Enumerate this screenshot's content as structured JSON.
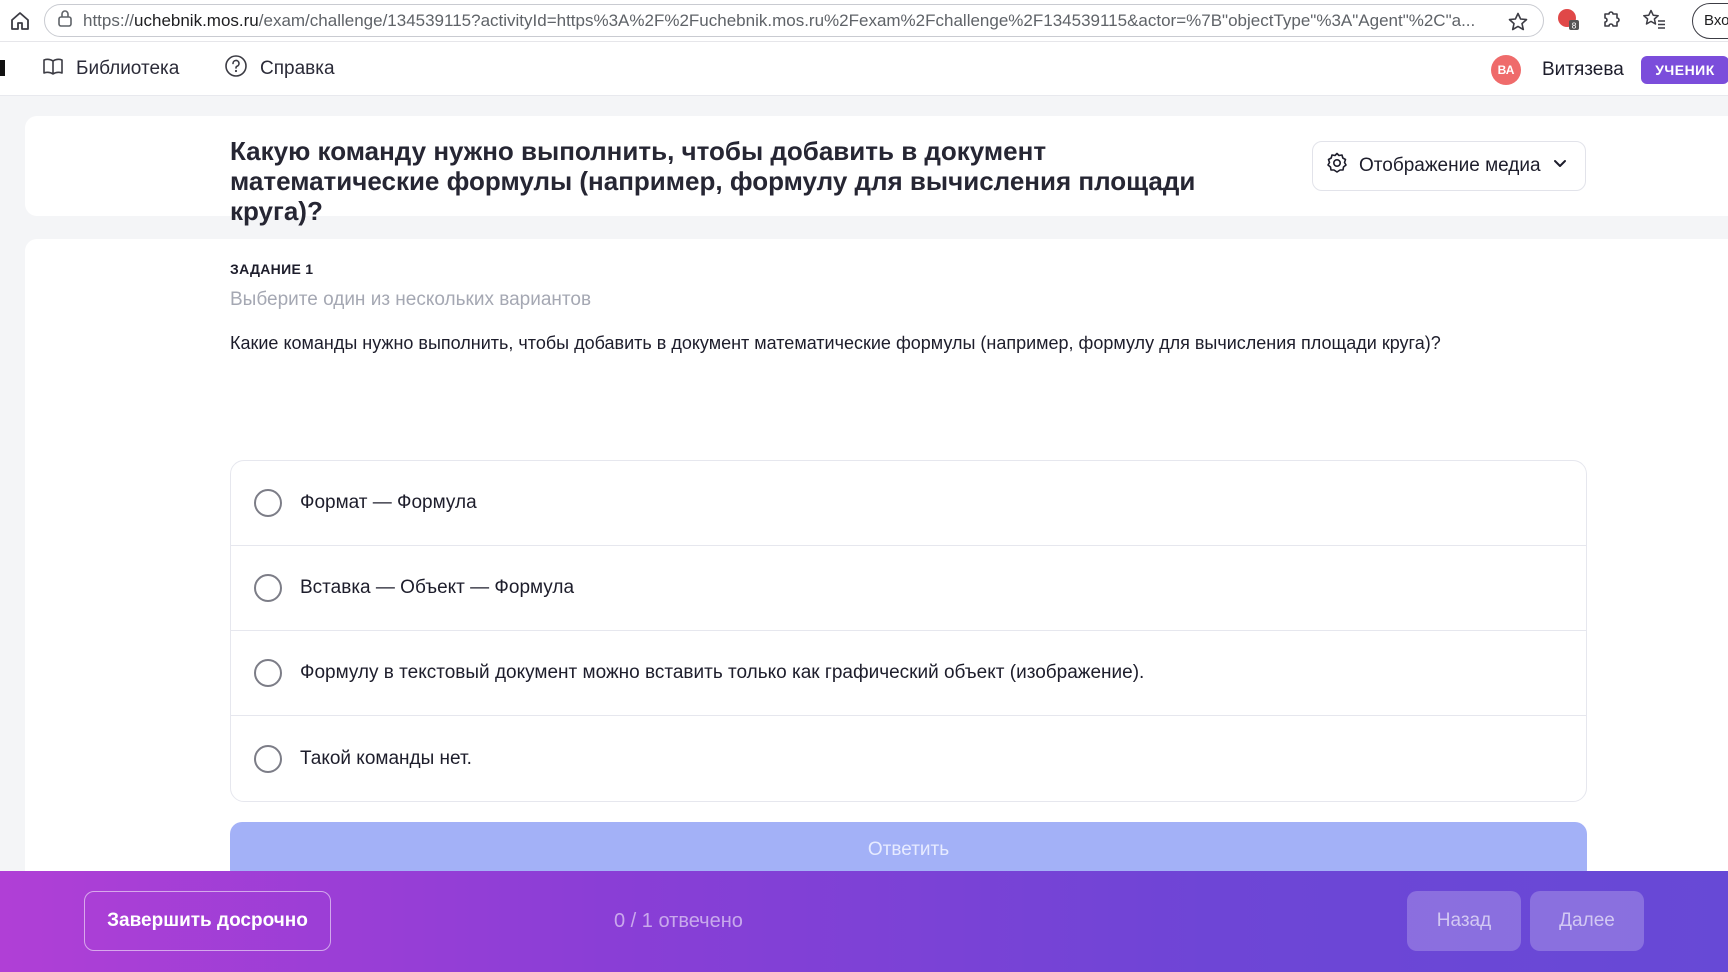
{
  "browser": {
    "url_prefix": "https://",
    "url_host": "uchebnik.mos.ru",
    "url_path": "/exam/challenge/134539115?activityId=https%3A%2F%2Fuchebnik.mos.ru%2Fexam%2Fchallenge%2F134539115&actor=%7B\"objectType\"%3A\"Agent\"%2C\"a...",
    "login_label": "Вход"
  },
  "nav": {
    "library_label": "Библиотека",
    "help_label": "Справка",
    "avatar_initials": "ВА",
    "user_name": "Витязева",
    "role_badge": "УЧЕНИК"
  },
  "header": {
    "title": "Какую команду нужно выполнить, чтобы добавить в документ математические формулы (например, формулу для вычисления площади круга)?",
    "media_label": "Отображение медиа"
  },
  "task": {
    "label": "ЗАДАНИЕ 1",
    "hint": "Выберите один из нескольких вариантов",
    "question": "Какие команды нужно выполнить, чтобы добавить в документ математические формулы (например, формулу для вычисления площади круга)?",
    "options": [
      {
        "label": "Формат — Формула"
      },
      {
        "label": "Вставка — Объект — Формула"
      },
      {
        "label": "Формулу в текстовый документ можно вставить только как графический объект (изображение)."
      },
      {
        "label": "Такой команды нет."
      }
    ],
    "answer_label": "Ответить"
  },
  "footer": {
    "finish_label": "Завершить досрочно",
    "progress": "0 / 1 отвечено",
    "back_label": "Назад",
    "next_label": "Далее"
  },
  "colors": {
    "accent": "#7b4ddb",
    "answer_button": "#a3b1f7",
    "avatar": "#ef6b6b"
  }
}
